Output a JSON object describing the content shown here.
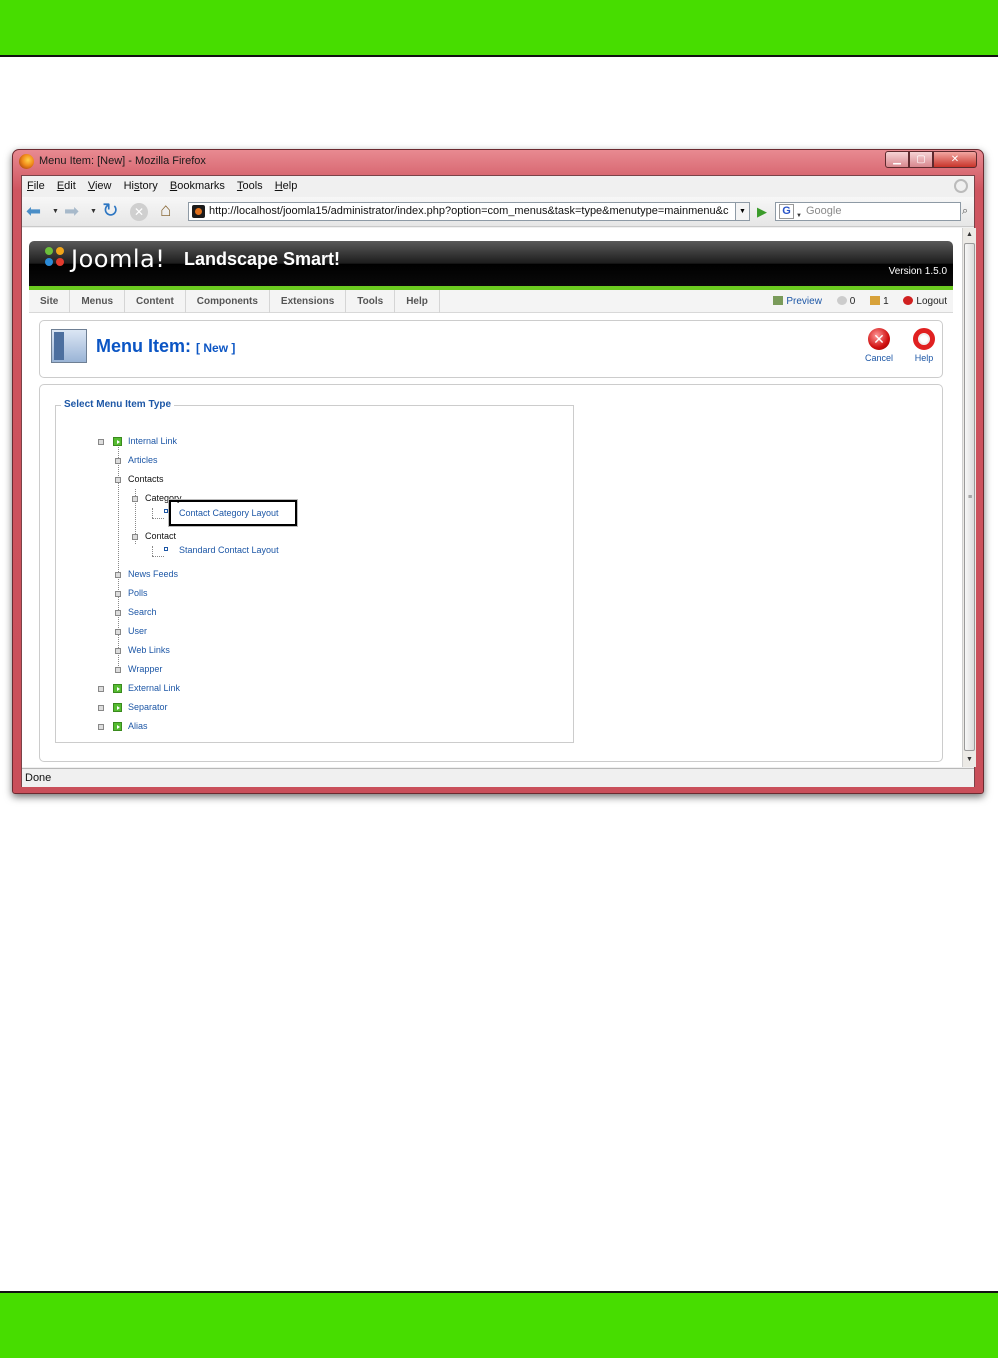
{
  "window": {
    "title": "Menu Item: [New] - Mozilla Firefox",
    "controls": [
      "minimize",
      "maximize",
      "close"
    ]
  },
  "browser": {
    "menu": [
      {
        "label": "File",
        "key": "F",
        "rest": "ile"
      },
      {
        "label": "Edit",
        "key": "E",
        "rest": "dit"
      },
      {
        "label": "View",
        "key": "V",
        "rest": "iew"
      },
      {
        "label": "History",
        "key": "s",
        "pre": "Hi",
        "rest": "tory"
      },
      {
        "label": "Bookmarks",
        "key": "B",
        "rest": "ookmarks"
      },
      {
        "label": "Tools",
        "key": "T",
        "rest": "ools"
      },
      {
        "label": "Help",
        "key": "H",
        "rest": "elp"
      }
    ],
    "url": "http://localhost/joomla15/administrator/index.php?option=com_menus&task=type&menutype=mainmenu&c",
    "search_placeholder": "Google",
    "status": "Done"
  },
  "joomla": {
    "logo_text": "Joomla!",
    "site_name": "Landscape Smart!",
    "version": "Version 1.5.0",
    "menu": [
      "Site",
      "Menus",
      "Content",
      "Components",
      "Extensions",
      "Tools",
      "Help"
    ],
    "right": {
      "preview": "Preview",
      "messages": "0",
      "users": "1",
      "logout": "Logout"
    },
    "page_title": "Menu Item:",
    "page_subtitle": "[ New ]",
    "buttons": {
      "cancel": "Cancel",
      "help": "Help"
    },
    "fieldset_legend": "Select Menu Item Type",
    "tree": {
      "internal_link": "Internal Link",
      "articles": "Articles",
      "contacts": "Contacts",
      "category": "Category",
      "contact_category_layout": "Contact Category Layout",
      "contact": "Contact",
      "standard_contact_layout": "Standard Contact Layout",
      "news_feeds": "News Feeds",
      "polls": "Polls",
      "search": "Search",
      "user": "User",
      "web_links": "Web Links",
      "wrapper": "Wrapper",
      "external_link": "External Link",
      "separator": "Separator",
      "alias": "Alias"
    },
    "highlighted_item": "Contact Category Layout"
  },
  "colors": {
    "band": "#47dd00",
    "link": "#1d57a6",
    "title": "#0b55c4",
    "joomla_green": "#6ccc20"
  }
}
